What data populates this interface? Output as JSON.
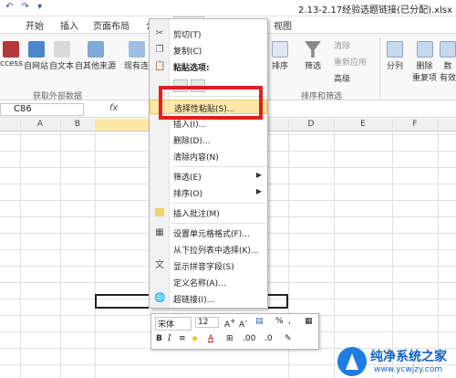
{
  "title_bar": {
    "quick_access": "↶ ↷ ▾",
    "document_title": "2.13-2.17经验选题链接(已分配).xlsx"
  },
  "tabs": {
    "file": "件",
    "items": [
      "开始",
      "插入",
      "页面布局",
      "公式",
      "数据",
      "审阅",
      "视图"
    ]
  },
  "ribbon": {
    "get_external": {
      "buttons": [
        "ccess",
        "自网站",
        "自文本",
        "自其他来源",
        "现有连"
      ],
      "label": "获取外部数据"
    },
    "sort_filter": {
      "sort": "排序",
      "filter": "筛选",
      "clear": "清除",
      "reapply": "重新应用",
      "advanced": "高级",
      "label": "排序和筛选"
    },
    "data_tools": {
      "split": "分列",
      "remove_dup": "删除\n重复项",
      "validate": "数\n有效"
    }
  },
  "formula_bar": {
    "name_box": "C86",
    "fx": "fx"
  },
  "columns": {
    "a": "A",
    "b": "B",
    "d": "D",
    "e": "E",
    "f": "F"
  },
  "context_menu": {
    "cut": "剪切(T)",
    "copy": "复制(C)",
    "paste_options": "粘贴选项:",
    "paste_special": "选择性粘贴(S)...",
    "insert": "插入(I)...",
    "delete": "删除(D)...",
    "clear": "清除内容(N)",
    "filter": "筛选(E)",
    "sort": "排序(O)",
    "insert_comment": "插入批注(M)",
    "format_cells": "设置单元格格式(F)...",
    "pick_list": "从下拉列表中选择(K)...",
    "phonetic": "显示拼音字段(S)",
    "define_name": "定义名称(A)...",
    "hyperlink": "超链接(I)..."
  },
  "mini_toolbar": {
    "font": "宋体",
    "size": "12",
    "percent": "%",
    "comma": ",",
    "bold": "B",
    "italic": "I"
  },
  "watermark": {
    "title": "纯净系统之家",
    "url": "www.ycwjzy.com"
  },
  "colors": {
    "excel_green": "#217346",
    "highlight": "#fde8a8",
    "red_box": "#e01f1f"
  }
}
